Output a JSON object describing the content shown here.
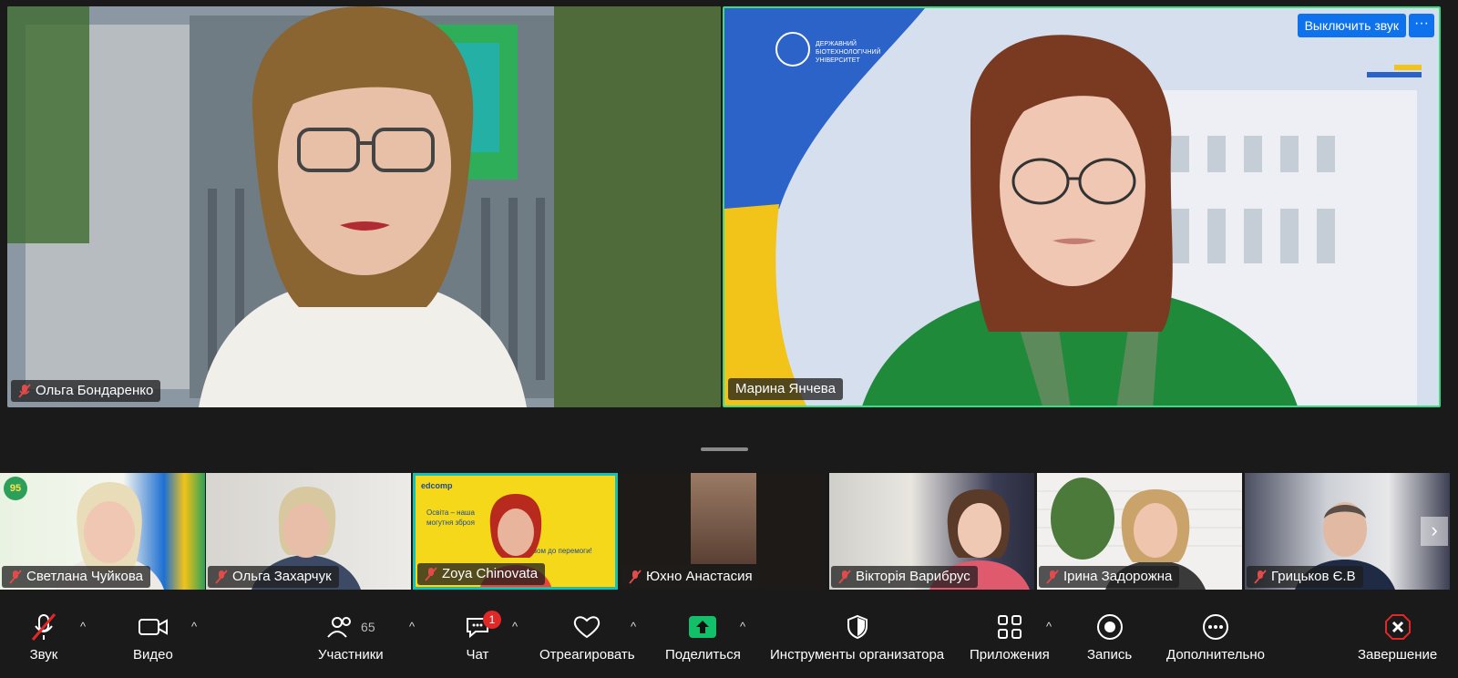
{
  "participants_main": [
    {
      "name": "Ольга Бондаренко",
      "muted": true
    },
    {
      "name": "Марина Янчева",
      "muted": false
    }
  ],
  "unmute_button": "Выключить звук",
  "more_button": "···",
  "banner_text": "ДЕРЖАВНИЙ БІОТЕХНОЛОГІЧНИЙ УНІВЕРСИТЕТ",
  "thumbnails": [
    {
      "name": "Светлана Чуйкова"
    },
    {
      "name": "Ольга Захарчук"
    },
    {
      "name": "Zoya Chinovata"
    },
    {
      "name": "Юхно Анастасия"
    },
    {
      "name": "Вікторія Варибрус"
    },
    {
      "name": "Ірина Задорожна"
    },
    {
      "name": "Грицьков Є.В"
    }
  ],
  "zoya_tile": {
    "brand": "edcomp",
    "text1": "Освіта – наша могутня зброя",
    "text2": "Разом до перемоги!"
  },
  "toolbar": {
    "audio": "Звук",
    "video": "Видео",
    "participants": "Участники",
    "participants_count": "65",
    "chat": "Чат",
    "chat_badge": "1",
    "react": "Отреагировать",
    "share": "Поделиться",
    "host_tools": "Инструменты организатора",
    "apps": "Приложения",
    "record": "Запись",
    "more": "Дополнительно",
    "end": "Завершение"
  },
  "colors": {
    "accent": "#0e72ed",
    "active_border": "#3ddc84",
    "share_green": "#12c06a",
    "end_red": "#e02828"
  }
}
